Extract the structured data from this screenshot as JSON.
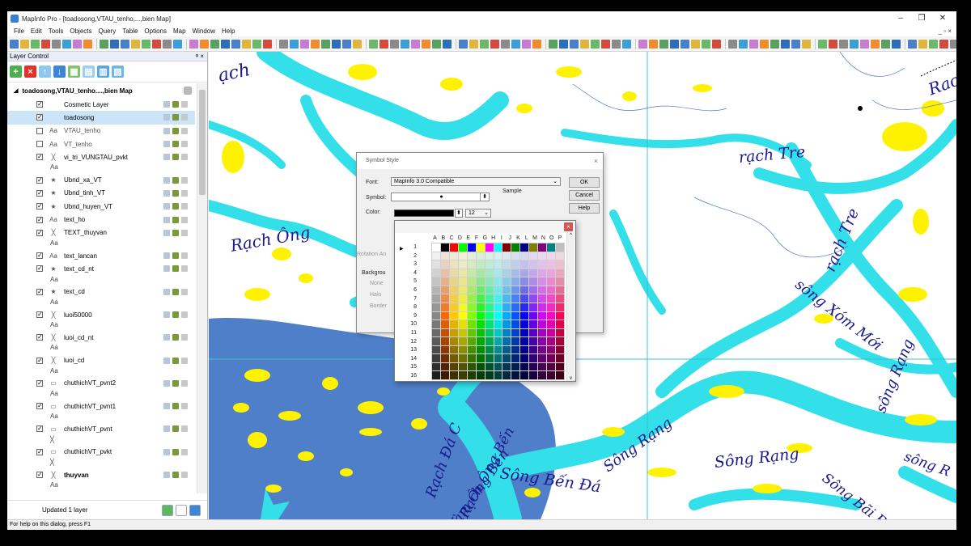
{
  "window": {
    "title": "MapInfo Pro - [toadosong,VTAU_tenho,...,bien Map]",
    "controls": [
      "–",
      "❐",
      "✕"
    ],
    "mdi_controls": "_ ▫ ×"
  },
  "menu": [
    "File",
    "Edit",
    "Tools",
    "Objects",
    "Query",
    "Table",
    "Options",
    "Map",
    "Window",
    "Help"
  ],
  "layer_control": {
    "title": "Layer Control",
    "pin": "ᵠ ×",
    "map_name": "toadosong,VTAU_tenho....,bien Map",
    "layers": [
      {
        "name": "Cosmetic Layer",
        "checked": "✓",
        "icon": "",
        "style": "",
        "selected": false
      },
      {
        "name": "toadosong",
        "checked": "✓",
        "icon": "",
        "style": "",
        "selected": true
      },
      {
        "name": "VTAU_tenho",
        "checked": "",
        "icon": "Aa",
        "style": "dim",
        "selected": false
      },
      {
        "name": "VT_tenho",
        "checked": "",
        "icon": "Aa",
        "style": "dim",
        "selected": false
      },
      {
        "name": "vi_tri_VUNGTAU_pvkt",
        "checked": "✓",
        "icon": "╳",
        "style": "",
        "selected": false,
        "sub": "Aa"
      },
      {
        "name": "Ubnd_xa_VT",
        "checked": "✓",
        "icon": "★",
        "style": "",
        "selected": false
      },
      {
        "name": "Ubnd_tinh_VT",
        "checked": "✓",
        "icon": "★",
        "style": "",
        "selected": false
      },
      {
        "name": "Ubnd_huyen_VT",
        "checked": "✓",
        "icon": "★",
        "style": "",
        "selected": false
      },
      {
        "name": "text_ho",
        "checked": "✓",
        "icon": "Aa",
        "style": "",
        "selected": false
      },
      {
        "name": "TEXT_thuyvan",
        "checked": "✓",
        "icon": "╳",
        "style": "",
        "selected": false,
        "sub": "Aa"
      },
      {
        "name": "text_lancan",
        "checked": "✓",
        "icon": "Aa",
        "style": "",
        "selected": false
      },
      {
        "name": "text_cd_nt",
        "checked": "✓",
        "icon": "★",
        "style": "",
        "selected": false,
        "sub": "Aa"
      },
      {
        "name": "text_cd",
        "checked": "✓",
        "icon": "★",
        "style": "",
        "selected": false,
        "sub": "Aa"
      },
      {
        "name": "luoi50000",
        "checked": "✓",
        "icon": "╳",
        "style": "",
        "selected": false,
        "sub": "Aa"
      },
      {
        "name": "luoi_cd_nt",
        "checked": "✓",
        "icon": "╳",
        "style": "",
        "selected": false,
        "sub": "Aa"
      },
      {
        "name": "luoi_cd",
        "checked": "✓",
        "icon": "╳",
        "style": "",
        "selected": false,
        "sub": "Aa"
      },
      {
        "name": "chuthichVT_pvnt2",
        "checked": "✓",
        "icon": "▭",
        "style": "",
        "selected": false,
        "sub": "Aa"
      },
      {
        "name": "chuthichVT_pvnt1",
        "checked": "✓",
        "icon": "▭",
        "style": "",
        "selected": false,
        "sub": "Aa"
      },
      {
        "name": "chuthichVT_pvnt",
        "checked": "✓",
        "icon": "▭",
        "style": "",
        "selected": false,
        "sub": "╳"
      },
      {
        "name": "chuthichVT_pvkt",
        "checked": "✓",
        "icon": "▭",
        "style": "",
        "selected": false,
        "sub": "╳"
      },
      {
        "name": "thuyvan",
        "checked": "✓",
        "icon": "╳",
        "style": "b",
        "selected": false,
        "sub": "Aa"
      }
    ],
    "status": "Updated 1 layer"
  },
  "symbol_dialog": {
    "title": "Symbol Style",
    "close": "×",
    "font_label": "Font:",
    "font_value": "MapInfo 3.0 Compatible",
    "symbol_label": "Symbol:",
    "symbol_value": "●",
    "color_label": "Color:",
    "size_value": "12",
    "sample_label": "Sample",
    "rotation_label": "Rotation An",
    "background_label": "Backgrou",
    "bg_options": [
      "None",
      "Halo",
      "Border"
    ],
    "ok_label": "OK",
    "cancel_label": "Cancel",
    "help_label": "Help",
    "dropdown_arrow": "⌄",
    "spin_arrow": "⬍"
  },
  "color_picker": {
    "close": "×",
    "columns": [
      "A",
      "B",
      "C",
      "D",
      "E",
      "F",
      "G",
      "H",
      "I",
      "J",
      "K",
      "L",
      "M",
      "N",
      "O",
      "P"
    ],
    "rows": [
      "1",
      "2",
      "3",
      "4",
      "5",
      "6",
      "7",
      "8",
      "9",
      "10",
      "11",
      "12",
      "13",
      "14",
      "15",
      "16"
    ],
    "row_arrow": "▶",
    "scroll_up": "^",
    "scroll_down": "v"
  },
  "map_labels": {
    "rach_ong": "Rạch Ông",
    "rach_tre_1": "rạch Tre",
    "rach_tre_2": "rạch Tre",
    "song_xom_moi": "sông Xóm Mới",
    "song_rang_1": "Sông Rạng",
    "song_rang_2": "Sông Rạng",
    "song_rang_3": "sông Rạng",
    "song_ben_da": "Sông Bến Đá",
    "rach_da": "Rạch Đá C",
    "rach_ong_ben": "Rạch Ông Bến",
    "vam_ong_ben": "Vàm Ông Bến",
    "song_bai": "Sông Bãi Bùn",
    "song_r_right": "sông R",
    "top_left": "ạch",
    "top_right": "Rac"
  },
  "statusbar": {
    "text": "For help on this dialog, press F1"
  },
  "colors": {
    "water": "#33dfe8",
    "sand": "#fff200",
    "sea": "#4f7fc8",
    "label": "#1a1a8c"
  }
}
